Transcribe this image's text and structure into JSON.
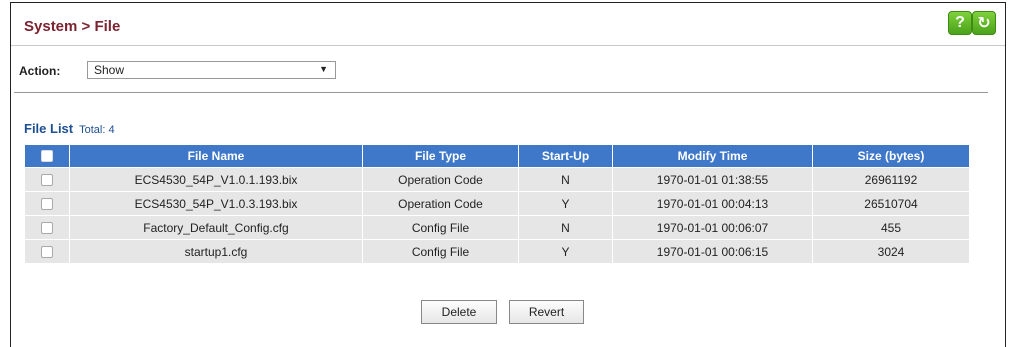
{
  "header": {
    "title": "System > File",
    "help_icon": "?",
    "refresh_icon": "↻"
  },
  "action": {
    "label": "Action:",
    "selected": "Show",
    "arrow": "▼"
  },
  "file_list": {
    "title": "File List",
    "total": "Total: 4"
  },
  "table": {
    "columns": [
      "File Name",
      "File Type",
      "Start-Up",
      "Modify Time",
      "Size (bytes)"
    ],
    "rows": [
      [
        "ECS4530_54P_V1.0.1.193.bix",
        "Operation Code",
        "N",
        "1970-01-01 01:38:55",
        "26961192"
      ],
      [
        "ECS4530_54P_V1.0.3.193.bix",
        "Operation Code",
        "Y",
        "1970-01-01 00:04:13",
        "26510704"
      ],
      [
        "Factory_Default_Config.cfg",
        "Config File",
        "N",
        "1970-01-01 00:06:07",
        "455"
      ],
      [
        "startup1.cfg",
        "Config File",
        "Y",
        "1970-01-01 00:06:15",
        "3024"
      ]
    ]
  },
  "buttons": {
    "delete": "Delete",
    "revert": "Revert"
  },
  "colors": {
    "title": "#7b2330",
    "table_header": "#3f78c8",
    "accent_green": "#5cb82a",
    "list_title": "#1d4f91"
  }
}
